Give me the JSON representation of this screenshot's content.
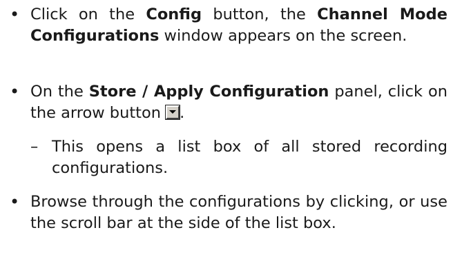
{
  "bullets": {
    "symbol": "•",
    "dash": "–"
  },
  "step1": {
    "t1": "Click on the ",
    "b1": "Config",
    "t2": " button, the ",
    "b2": "Channel Mode Configurations",
    "t3": " window appears on the screen."
  },
  "step2": {
    "t1": "On the ",
    "b1": "Store / Apply Configuration",
    "t2": " panel, click on the arrow button",
    "t3": "."
  },
  "step2_sub": {
    "text": "This opens a list box of all stored recording configurations."
  },
  "step3": {
    "text": "Browse through the configurations by clicking, or use the scroll bar at the side of the list box."
  },
  "icons": {
    "arrow_button": "dropdown-arrow-icon"
  }
}
